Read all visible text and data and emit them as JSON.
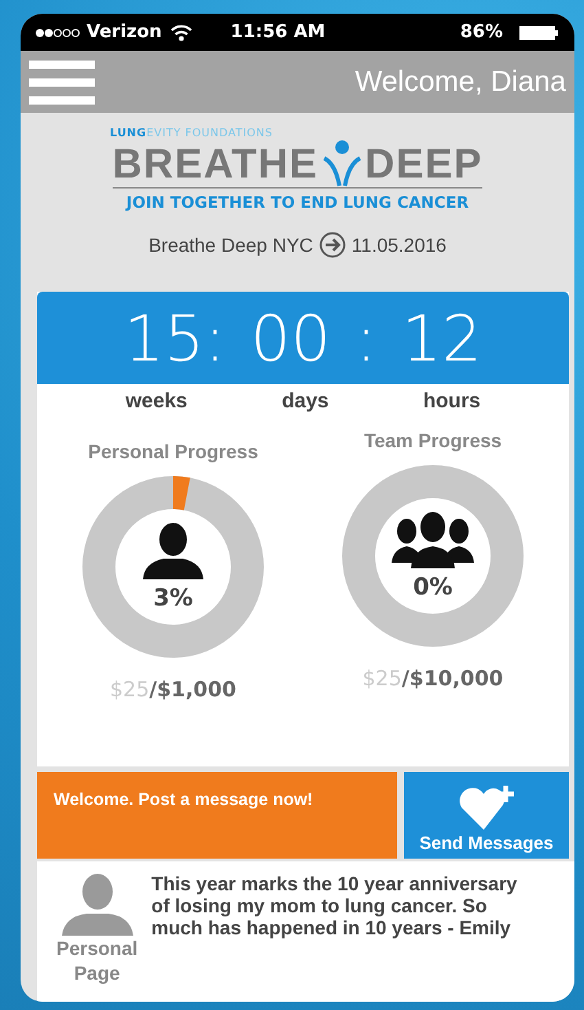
{
  "status_bar": {
    "carrier": "Verizon",
    "time": "11:56 AM",
    "battery": "86%"
  },
  "header": {
    "greeting": "Welcome, Diana"
  },
  "logo": {
    "foundation": "**LUNG**EVITY FOUNDATIONS",
    "word_left": "BREATHE",
    "word_right": "DEEP",
    "tagline": "JOIN TOGETHER TO END LUNG CANCER"
  },
  "event": {
    "name": "Breathe Deep NYC",
    "date": "11.05.2016"
  },
  "countdown": {
    "weeks": "15:",
    "days": "00",
    "separator": ":",
    "hours": "12",
    "units": [
      "weeks",
      "days",
      "hours"
    ]
  },
  "progress": [
    {
      "kind": "personal",
      "title": "Personal Progress",
      "percent": "3%",
      "raised": "$25",
      "goal": "/$1,000"
    },
    {
      "kind": "team",
      "title": "Team Progress",
      "percent": "0%",
      "raised": "$25",
      "goal": "/$10,000"
    }
  ],
  "message_banner": {
    "text": "Welcome. Post a message now!"
  },
  "send_button": {
    "label": "Send Messages"
  },
  "post": {
    "avatar_label": "Personal Page",
    "text": "This year marks the 10 year anniversary of losing my mom to lung cancer. So much has happened in 10 years - Emily"
  }
}
